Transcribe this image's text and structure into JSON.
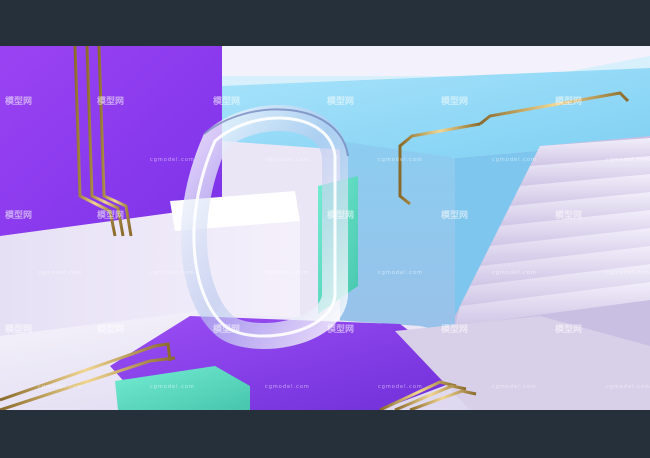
{
  "image": {
    "kind": "3d-render",
    "subject": "abstract pastel geometric scene with glass ring, stairs and gold pipes",
    "palette": {
      "letterbox": "#25303b",
      "purple": "#8a3cf0",
      "sky_blue": "#8ed3f2",
      "teal": "#5fe0c4",
      "lavender_white": "#e9e4f6",
      "gold": "#c9a65a"
    }
  },
  "watermark": {
    "logo_text": "模型网",
    "site_text": "cgmodel.com"
  }
}
